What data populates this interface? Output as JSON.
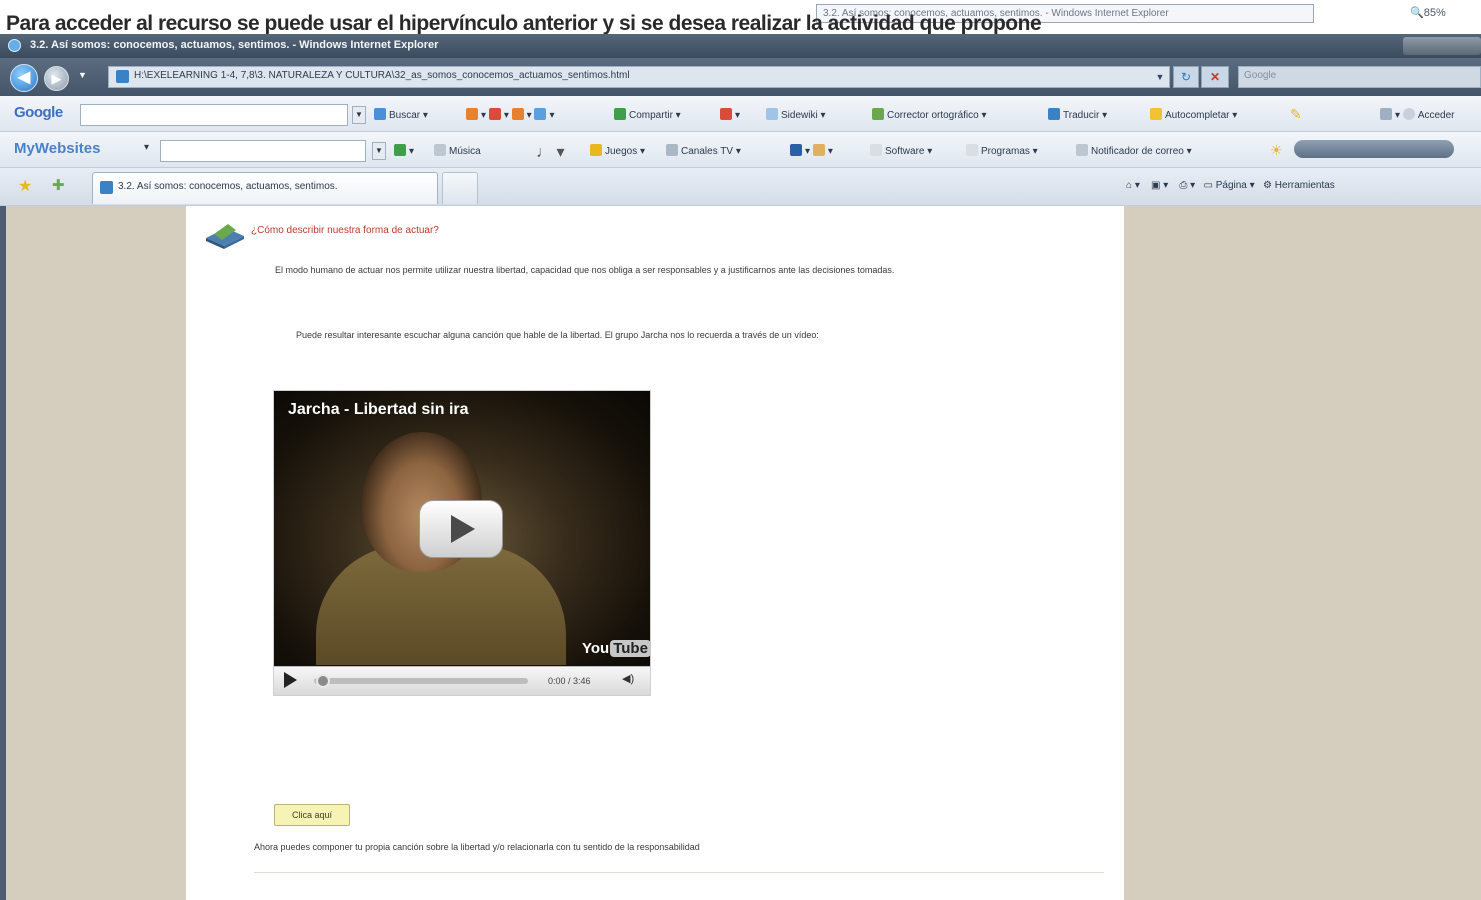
{
  "overlay": {
    "top_text": "Para acceder al recurso se puede usar el hipervínculo anterior y si se desea realizar la actividad que propone",
    "taskbar_item": "3.2. Así somos: conocemos, actuamos, sentimos. - Windows Internet Explorer",
    "zoom": "85%"
  },
  "window": {
    "title": "3.2. Así somos: conocemos, actuamos, sentimos. - Windows Internet Explorer"
  },
  "address": {
    "url": "H:\\EXELEARNING 1-4, 7,8\\3. NATURALEZA Y CULTURA\\32_as_somos_conocemos_actuamos_sentimos.html",
    "search_placeholder": "Google"
  },
  "google_toolbar": {
    "logo": "Google",
    "items": [
      "Buscar",
      "Compartir",
      "Sidewiki",
      "Corrector ortográfico",
      "Traducir",
      "Autocompletar",
      "Acceder"
    ]
  },
  "mywebsites_toolbar": {
    "logo": "MyWebsites",
    "items": [
      "Música",
      "Juegos",
      "Canales TV",
      "Software",
      "Programas",
      "Notificador de correo"
    ]
  },
  "tabs": {
    "active_label": "3.2. Así somos: conocemos, actuamos, sentimos."
  },
  "command_bar": {
    "items": [
      "Página",
      "Herramientas"
    ]
  },
  "content": {
    "heading": "¿Cómo describir nuestra forma de actuar?",
    "paragraph_1": "El modo humano de actuar nos permite utilizar nuestra libertad, capacidad que nos obliga a ser responsables y a justificarnos ante las decisiones tomadas.",
    "paragraph_2": "Puede resultar interesante escuchar alguna canción que hable de la libertad. El grupo Jarcha nos lo recuerda a través de un vídeo:",
    "video": {
      "title": "Jarcha - Libertad sin ira",
      "time": "0:00 / 3:46",
      "progress_fraction": 0.0,
      "brand_you": "You",
      "brand_tube": "Tube"
    },
    "button_label": "Clica aquí",
    "final_text": "Ahora puedes componer tu propia canción sobre la libertad y/o relacionarla con tu sentido de la responsabilidad"
  },
  "colors": {
    "heading": "#c0392b",
    "page_bg": "#d5cdbd",
    "button_bg": "#f7f3b5"
  }
}
